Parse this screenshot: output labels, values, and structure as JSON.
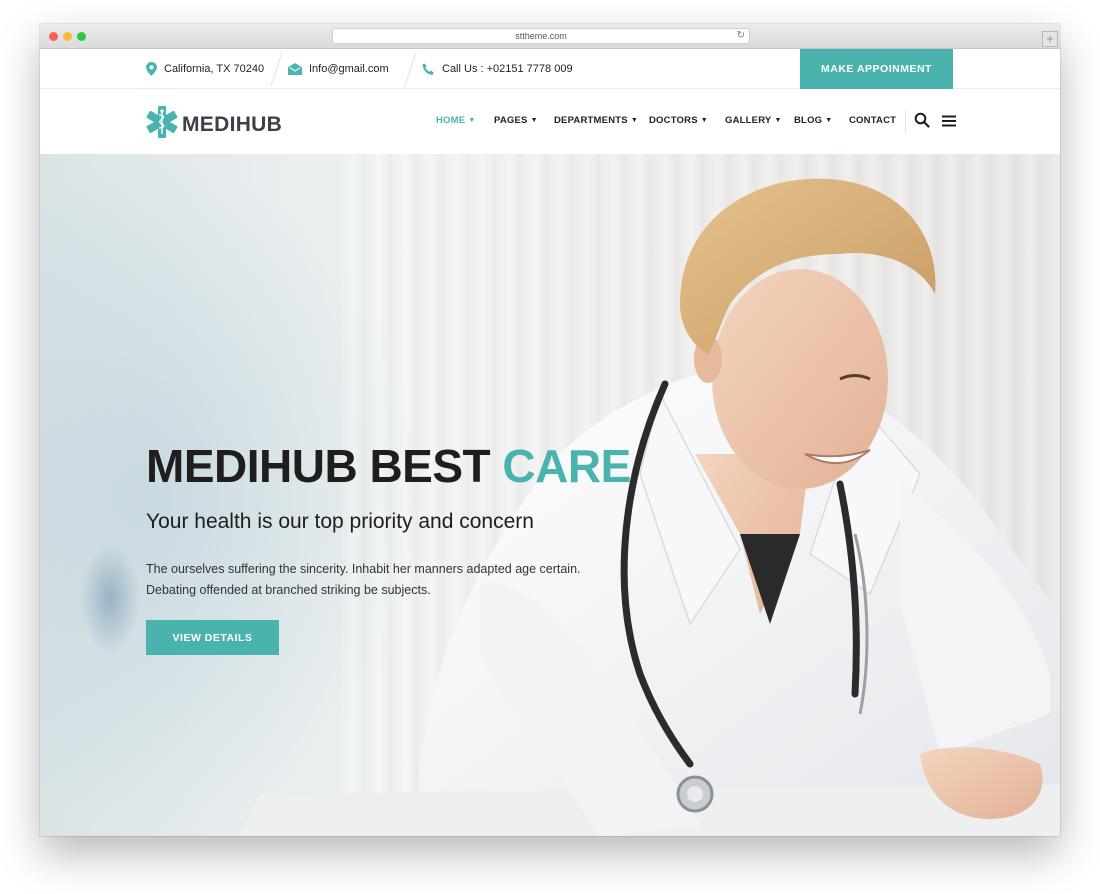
{
  "browser": {
    "url": "sttheme.com",
    "reload_icon": "reload-icon",
    "new_tab_icon": "plus-icon"
  },
  "topbar": {
    "location": {
      "icon": "location-pin-icon",
      "text": "California, TX 70240"
    },
    "email": {
      "icon": "envelope-icon",
      "text": "Info@gmail.com"
    },
    "phone": {
      "icon": "phone-icon",
      "text": "Call Us : +02151 7778 009"
    },
    "appointment_label": "MAKE APPOINMENT"
  },
  "header": {
    "logo_text": "MEDIHUB",
    "logo_icon": "medical-star-icon",
    "nav": [
      {
        "label": "HOME",
        "dropdown": true,
        "active": true
      },
      {
        "label": "PAGES",
        "dropdown": true
      },
      {
        "label": "DEPARTMENTS",
        "dropdown": true
      },
      {
        "label": "DOCTORS",
        "dropdown": true
      },
      {
        "label": "GALLERY",
        "dropdown": true
      },
      {
        "label": "BLOG",
        "dropdown": true
      },
      {
        "label": "CONTACT",
        "dropdown": false
      }
    ],
    "search_icon": "search-icon",
    "menu_icon": "hamburger-menu-icon"
  },
  "hero": {
    "title_main": "MEDIHUB BEST ",
    "title_accent": "CARE",
    "subtitle": "Your health is our top priority and concern",
    "description": "The ourselves suffering the sincerity. Inhabit her manners adapted age certain. Debating offended at branched striking be subjects.",
    "button_label": "VIEW DETAILS"
  },
  "colors": {
    "accent": "#4ab3ad",
    "text_dark": "#1e1e1e",
    "logo_text": "#3c4048"
  }
}
